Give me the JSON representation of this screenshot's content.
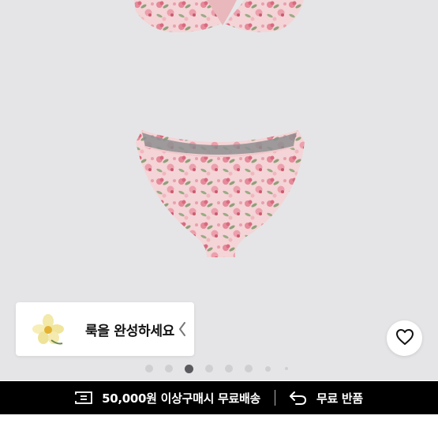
{
  "look_card": {
    "label": "룩을 완성하세요",
    "thumb_icon": "flower-thumbnail",
    "chevron_icon": "chevron-left-icon"
  },
  "wishlist": {
    "icon": "heart-icon"
  },
  "carousel": {
    "dot_count": 8,
    "active_index": 2
  },
  "promo": {
    "shipping_text": "50,000원 이상구매시 무료배송",
    "shipping_icon": "shipping-icon",
    "return_text": "무료 반품",
    "return_icon": "return-arrow-icon"
  },
  "colors": {
    "image_background": "#e5e5e7",
    "promo_background": "#000000",
    "fabric_pink": "#f5d7d8"
  }
}
